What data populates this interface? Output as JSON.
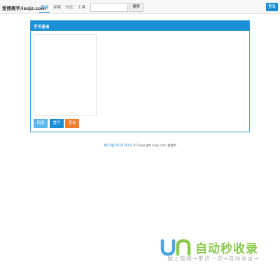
{
  "navbar": {
    "brand": "爱搜阁字/isojz.com",
    "links": [
      "查询",
      "探索",
      "讨论",
      "工具"
    ],
    "search": {
      "value": "",
      "placeholder": "",
      "button_label": "搜索"
    },
    "login_label": "登录"
  },
  "panel": {
    "title": "手写查询",
    "buttons": {
      "back": "回退",
      "rewrite": "重写",
      "query": "查询"
    }
  },
  "footer": {
    "icp": "粤ICP备15105342号",
    "copyright": " © Copyright isojz.com. 搜搜字"
  },
  "watermark": {
    "title": "自动秒收录",
    "subtitle": "做上链接→来访一次→自动收录→"
  },
  "colors": {
    "accent": "#1a8fd6",
    "button_light": "#5bb9f0",
    "button_orange": "#f0802a",
    "watermark_green": "#88c94a",
    "watermark_blue": "#4fa3e0"
  }
}
